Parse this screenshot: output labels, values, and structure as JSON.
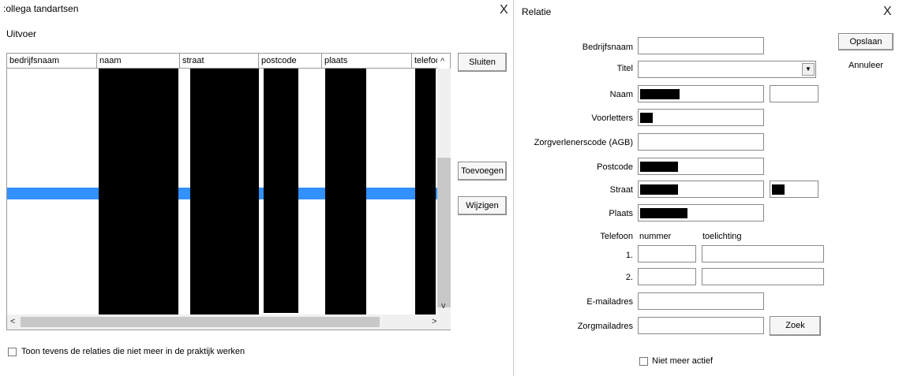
{
  "colors": {
    "selection": "#3390ff",
    "redaction": "#000000",
    "window_bg": "#ffffff",
    "border": "#8a8a8a"
  },
  "left_window": {
    "title": ":ollega tandartsen",
    "close_glyph": "X",
    "menu": "Uitvoer",
    "columns": [
      "bedrijfsnaam",
      "naam",
      "straat",
      "postcode",
      "plaats",
      "telefoor"
    ],
    "buttons": {
      "close": "Sluiten",
      "add": "Toevoegen",
      "edit": "Wijzigen"
    },
    "checkbox_label": "Toon tevens de relaties die niet meer in de praktijk werken",
    "scroll_up": "^",
    "scroll_down": "v",
    "scroll_left": "<",
    "scroll_right": ">"
  },
  "right_window": {
    "title": "Relatie",
    "close_glyph": "X",
    "buttons": {
      "save": "Opslaan",
      "cancel": "Annuleer",
      "search": "Zoek"
    },
    "labels": {
      "company": "Bedrijfsnaam",
      "title": "Titel",
      "name": "Naam",
      "initials": "Voorletters",
      "agb": "Zorgverlenerscode (AGB)",
      "postcode": "Postcode",
      "street": "Straat",
      "city": "Plaats",
      "phone": "Telefoon",
      "phone_number_header": "nummer",
      "phone_note_header": "toelichting",
      "phone_1": "1.",
      "phone_2": "2.",
      "email": "E-mailadres",
      "zorgmail": "Zorgmailadres",
      "inactive": "Niet meer actief"
    },
    "select_arrow": "▼"
  }
}
